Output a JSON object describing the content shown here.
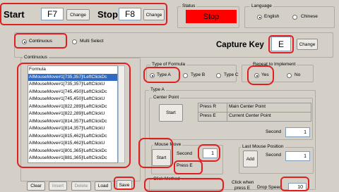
{
  "hotkeys": {
    "start_label": "Start",
    "start_key": "F7",
    "stop_label": "Stop",
    "stop_key": "F8",
    "change_label": "Change"
  },
  "status": {
    "caption": "Status",
    "value": "Stop",
    "color": "#ff0000"
  },
  "language": {
    "caption": "Language",
    "options": [
      "English",
      "Chinese"
    ],
    "selected": "English"
  },
  "mode": {
    "options": [
      "Continuous",
      "Multi Select"
    ],
    "selected": "Continuous"
  },
  "capture": {
    "label": "Capture Key",
    "key": "E",
    "change_label": "Change"
  },
  "continuous_group": {
    "caption": "Continuous",
    "list_header": "Formula",
    "items": [
      "AIMouseMove#1[735,357]!LeftClickDc",
      "AIMouseMove#1[735,357]!LeftClickU",
      "AIMouseMove#1[745,450]!LeftClickDc",
      "AIMouseMove#1[745,450]!LeftClickU",
      "AIMouseMove#1[822,289]!LeftClickDc",
      "AIMouseMove#1[822,289]!LeftClickU",
      "AIMouseMove#1[814,357]!LeftClickDc",
      "AIMouseMove#1[814,357]!LeftClickU",
      "AIMouseMove#1[815,462]!LeftClickDc",
      "AIMouseMove#1[815,462]!LeftClickU",
      "AIMouseMove#1[801,365]!LeftClickDc",
      "AIMouseMove#1[881,365]!LeftClickDc"
    ],
    "selected_index": 0
  },
  "bottom_buttons": [
    "Clear",
    "Insert",
    "Delete",
    "Load",
    "Save"
  ],
  "formula_type": {
    "caption": "Type of Formula",
    "options": [
      "Type A",
      "Type B",
      "Type C"
    ],
    "selected": "Type A"
  },
  "repeat": {
    "caption": "Repeat to Implement",
    "options": [
      "Yes",
      "No"
    ],
    "selected": "Yes"
  },
  "type_a": {
    "caption": "Type A",
    "center_point": {
      "caption": "Center Point",
      "start_label": "Start",
      "rows": [
        {
          "key": "Press R",
          "desc": "Main Center Point"
        },
        {
          "key": "Press E",
          "desc": "Current Center Point"
        }
      ],
      "second_label": "Second",
      "second_value": "1"
    },
    "mouse_move": {
      "caption": "Mouse Move",
      "start_label": "Start",
      "second_label": "Second",
      "second_value": "1",
      "press_label": "Press E"
    },
    "last_mouse": {
      "caption": "Last Mouse Position",
      "add_label": "Add",
      "second_label": "Second",
      "second_value": "1"
    },
    "click_method": {
      "caption": "Click Method"
    },
    "click_when": {
      "label": "Click when",
      "label2": "press E"
    },
    "drop_speed": {
      "label": "Drop Speed",
      "value": "10"
    }
  }
}
